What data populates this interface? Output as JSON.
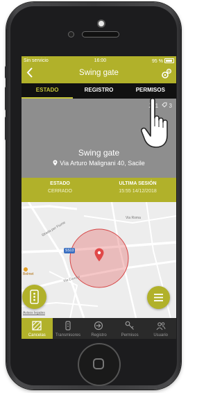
{
  "status_bar": {
    "carrier": "Sin servicio",
    "time": "16:00",
    "battery": "95 %"
  },
  "app_bar": {
    "back_icon": "chevron-left-icon",
    "title": "Swing gate",
    "settings_icon": "gear-icon"
  },
  "tabs": [
    {
      "label": "ESTADO",
      "active": true
    },
    {
      "label": "REGISTRO",
      "active": false
    },
    {
      "label": "PERMISOS",
      "active": false
    }
  ],
  "device": {
    "users_count": "1",
    "keys_count": "3",
    "name": "Swing gate",
    "address": "Via Arturo Malignani 40, Sacile"
  },
  "status_info": {
    "state_header": "ESTADO",
    "state_value": "CERRADO",
    "last_session_header": "ULTIMA SESIÓN",
    "last_session_value": "15:55 14/12/2018"
  },
  "map": {
    "road_badge": "SS13",
    "poi_label": "Belmet",
    "legal_label": "Avisos legales",
    "street_labels": [
      "Strada per Fiume",
      "Via Roma",
      "Via Cavour"
    ]
  },
  "bottom_nav": [
    {
      "label": "Cancelas",
      "icon": "gate-icon",
      "active": true
    },
    {
      "label": "Transmisores",
      "icon": "remote-icon",
      "active": false
    },
    {
      "label": "Registro",
      "icon": "login-icon",
      "active": false
    },
    {
      "label": "Permisos",
      "icon": "key-icon",
      "active": false
    },
    {
      "label": "Usuario",
      "icon": "users-icon",
      "active": false
    }
  ],
  "colors": {
    "accent": "#b1b12a",
    "hero_gray": "#8e8e8e",
    "tab_bar": "#111111",
    "nav_bar": "#2a2a2a"
  }
}
